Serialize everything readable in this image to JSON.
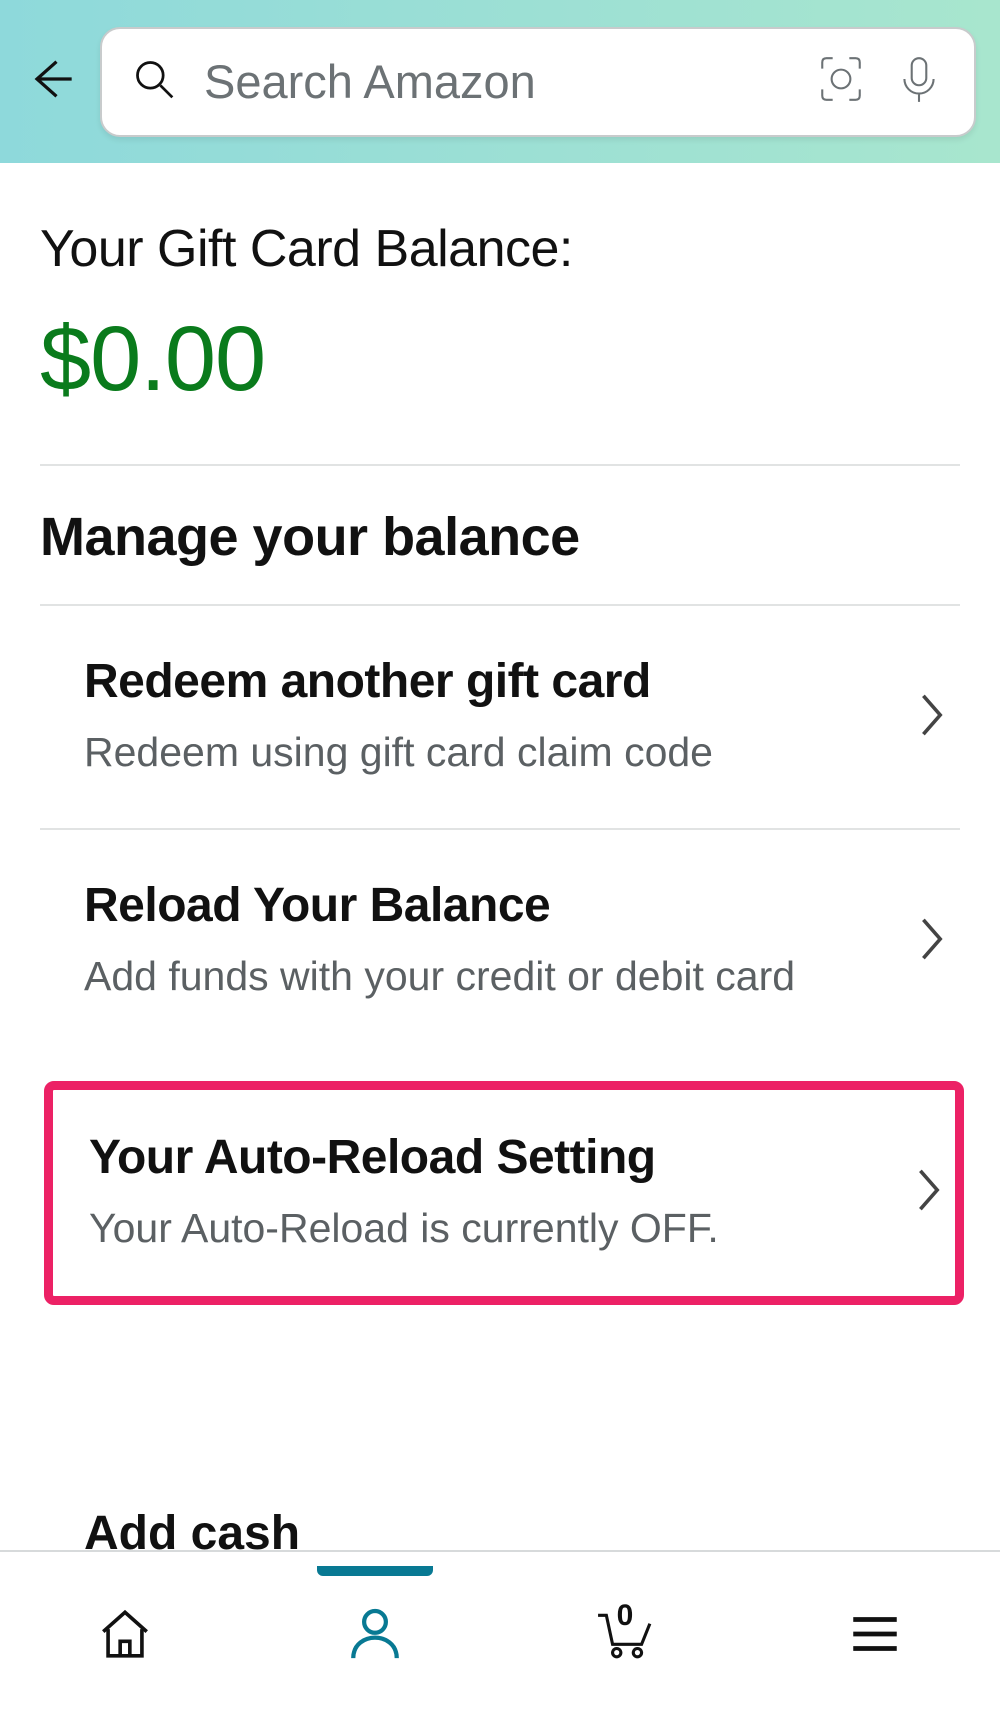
{
  "header": {
    "search_placeholder": "Search Amazon"
  },
  "balance": {
    "label": "Your Gift Card Balance:",
    "value": "$0.00"
  },
  "section": {
    "title": "Manage your balance"
  },
  "menu": {
    "redeem": {
      "title": "Redeem another gift card",
      "subtitle": "Redeem using gift card claim code"
    },
    "reload": {
      "title": "Reload Your Balance",
      "subtitle": "Add funds with your credit or debit card"
    },
    "autoreload": {
      "title": "Your Auto-Reload Setting",
      "subtitle": "Your Auto-Reload is currently OFF."
    },
    "addcash": {
      "title": "Add cash"
    }
  },
  "bottombar": {
    "cart_count": "0"
  }
}
